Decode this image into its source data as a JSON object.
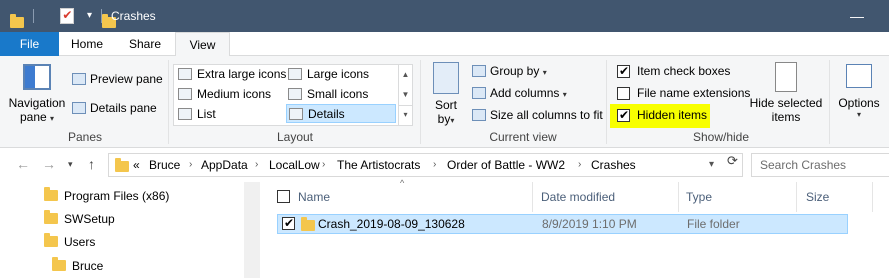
{
  "window": {
    "title": "Crashes",
    "minimize": "—"
  },
  "tabs": [
    {
      "label": "File"
    },
    {
      "label": "Home"
    },
    {
      "label": "Share"
    },
    {
      "label": "View"
    }
  ],
  "ribbon": {
    "panes": {
      "label": "Panes",
      "navigation_pane": "Navigation",
      "navigation_pane_2": "pane",
      "preview_pane": "Preview pane",
      "details_pane": "Details pane"
    },
    "layout": {
      "label": "Layout",
      "items": [
        {
          "label": "Extra large icons"
        },
        {
          "label": "Large icons"
        },
        {
          "label": "Medium icons"
        },
        {
          "label": "Small icons"
        },
        {
          "label": "List"
        },
        {
          "label": "Details",
          "selected": true
        }
      ]
    },
    "current_view": {
      "label": "Current view",
      "sort_by": "Sort",
      "sort_by_2": "by",
      "group_by": "Group by",
      "add_columns": "Add columns",
      "size_all_columns": "Size all columns to fit"
    },
    "show_hide": {
      "label": "Show/hide",
      "item_check_boxes": {
        "label": "Item check boxes",
        "checked": true
      },
      "file_name_extensions": {
        "label": "File name extensions",
        "checked": false
      },
      "hidden_items": {
        "label": "Hidden items",
        "checked": true
      },
      "hide_selected": "Hide selected",
      "hide_selected_2": "items"
    },
    "options": {
      "label": "Options"
    }
  },
  "address": {
    "overflow": "«",
    "crumbs": [
      "Bruce",
      "AppData",
      "LocalLow",
      "The Artistocrats",
      "Order of Battle - WW2",
      "Crashes"
    ],
    "search_placeholder": "Search Crashes"
  },
  "tree": [
    {
      "label": "Program Files (x86)"
    },
    {
      "label": "SWSetup"
    },
    {
      "label": "Users"
    },
    {
      "label": "Bruce"
    }
  ],
  "columns": [
    "Name",
    "Date modified",
    "Type",
    "Size"
  ],
  "files": [
    {
      "name": "Crash_2019-08-09_130628",
      "date": "8/9/2019 1:10 PM",
      "type": "File folder",
      "size": "",
      "checked": true
    }
  ],
  "colors": {
    "titlebar": "#41566f",
    "file_tab": "#1979ca",
    "selection": "#cce8ff",
    "highlight": "#f8ff00"
  }
}
